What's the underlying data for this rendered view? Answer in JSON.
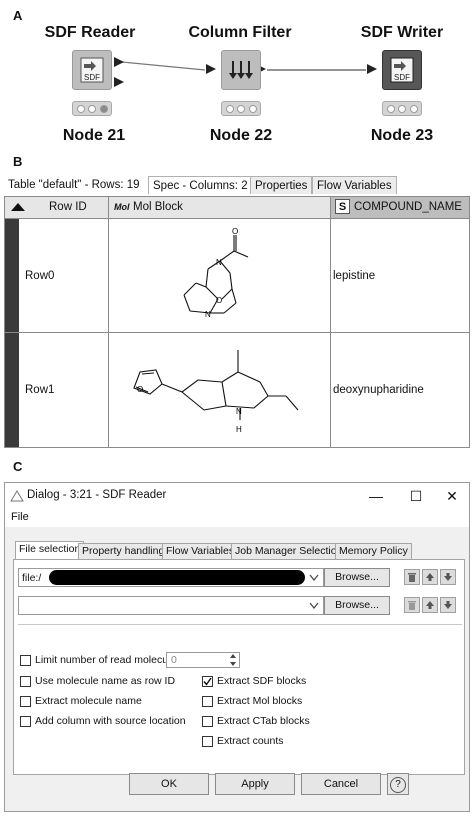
{
  "panels": {
    "a": "A",
    "b": "B",
    "c": "C"
  },
  "workflow": {
    "nodes": [
      {
        "title": "SDF Reader",
        "icon_text": "SDF",
        "name": "Node 21"
      },
      {
        "title": "Column Filter",
        "icon_text": "",
        "name": "Node 22"
      },
      {
        "title": "SDF Writer",
        "icon_text": "SDF",
        "name": "Node 23"
      }
    ]
  },
  "table": {
    "caption": "Table \"default\" - Rows: 19",
    "tabs": [
      "Spec - Columns: 2",
      "Properties",
      "Flow Variables"
    ],
    "headers": {
      "row_id": "Row ID",
      "mol_block_icon": "Mol",
      "mol_block": "Mol Block",
      "compound_icon": "S",
      "compound": "COMPOUND_NAME"
    },
    "rows": [
      {
        "id": "Row0",
        "compound": "lepistine"
      },
      {
        "id": "Row1",
        "compound": "deoxynupharidine"
      }
    ],
    "mol_atoms": {
      "n": "N",
      "o": "O",
      "h": "H"
    }
  },
  "dialog": {
    "title": "Dialog - 3:21 - SDF Reader",
    "menu": "File",
    "window_buttons": {
      "minimize": "—",
      "maximize": "☐",
      "close": "✕"
    },
    "tabs": [
      "File selection",
      "Property handling",
      "Flow Variables",
      "Job Manager Selection",
      "Memory Policy"
    ],
    "file_prefix": "file:/",
    "browse_label": "Browse...",
    "options": {
      "limit": "Limit number of read molecules",
      "limit_value": "0",
      "use_name": "Use molecule name as row ID",
      "extract_name": "Extract molecule name",
      "add_column": "Add column with source location",
      "extract_sdf": "Extract SDF blocks",
      "extract_mol": "Extract Mol blocks",
      "extract_ctab": "Extract CTab blocks",
      "extract_counts": "Extract counts"
    },
    "buttons": {
      "ok": "OK",
      "apply": "Apply",
      "cancel": "Cancel",
      "help": "?"
    }
  },
  "colors": {
    "node_grey": "#bdbdbd",
    "node_dark": "#575757",
    "row_marker": "#3a3a3a"
  }
}
